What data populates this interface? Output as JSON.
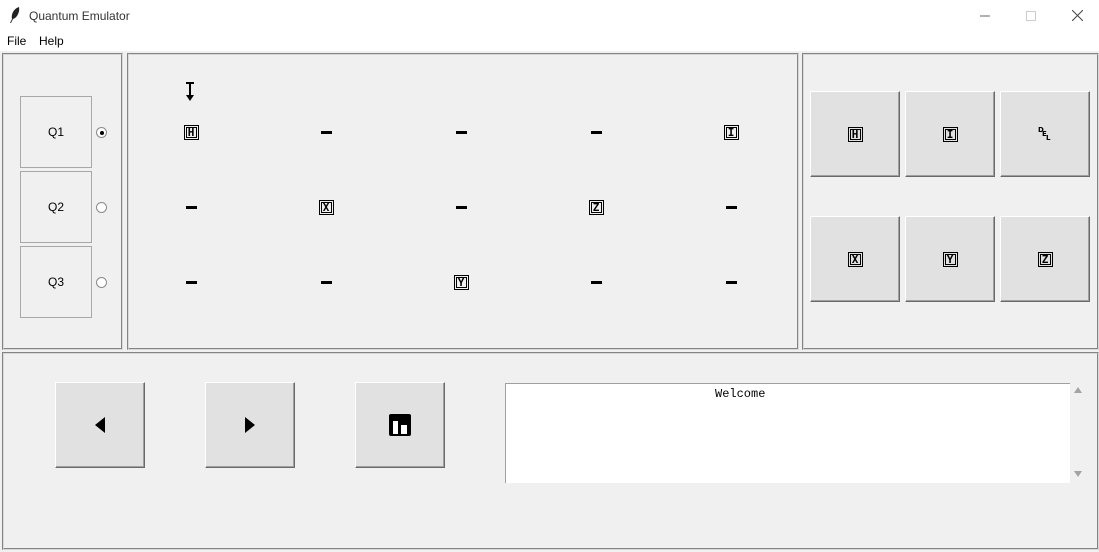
{
  "window": {
    "title": "Quantum Emulator",
    "icon": "feather-icon"
  },
  "menu": {
    "file": "File",
    "help": "Help"
  },
  "qubits": [
    {
      "label": "Q1",
      "selected": true
    },
    {
      "label": "Q2",
      "selected": false
    },
    {
      "label": "Q3",
      "selected": false
    }
  ],
  "circuit": {
    "cursor_icon": "insertion-cursor-icon",
    "rows": [
      [
        "H",
        "-",
        "-",
        "-",
        "I"
      ],
      [
        "-",
        "X",
        "-",
        "Z",
        "-"
      ],
      [
        "-",
        "-",
        "Y",
        "-",
        "-"
      ]
    ]
  },
  "gates": {
    "h": "H",
    "i": "I",
    "del_letters": [
      "D",
      "E",
      "L"
    ],
    "x": "X",
    "y": "Y",
    "z": "Z"
  },
  "controls": {
    "prev_icon": "triangle-left-icon",
    "next_icon": "triangle-right-icon",
    "save_icon": "save-icon"
  },
  "output": {
    "text": "Welcome"
  }
}
